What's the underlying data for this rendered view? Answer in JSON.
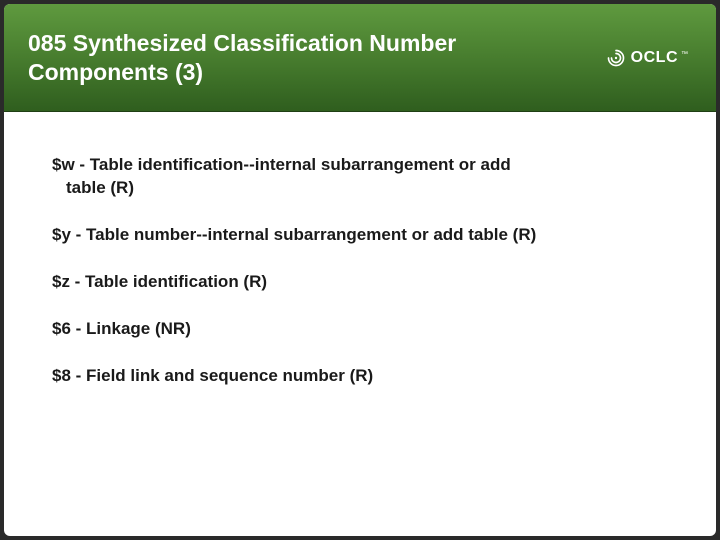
{
  "header": {
    "title": "085 Synthesized Classification Number Components (3)",
    "logo_text": "OCLC",
    "logo_tm": "™"
  },
  "items": {
    "w_line1": "$w - Table identification--internal subarrangement or add",
    "w_line2": "table (R)",
    "y": "$y - Table number--internal subarrangement or add table  (R)",
    "z": "$z - Table identification (R)",
    "six": "$6 - Linkage (NR)",
    "eight": "$8 - Field link and sequence number (R)"
  }
}
